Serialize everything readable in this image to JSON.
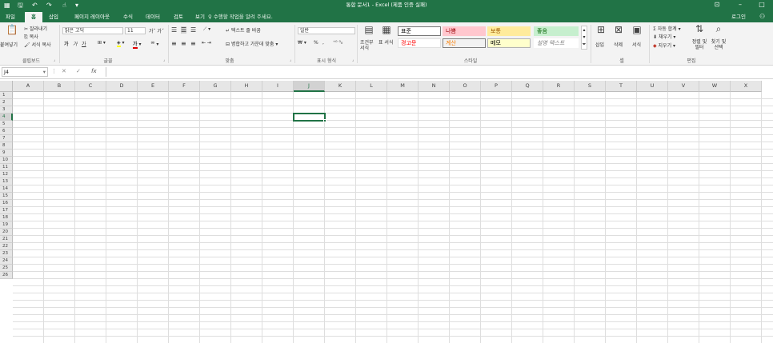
{
  "window": {
    "title": "통합 문서1 - Excel (제품 인증 실패)",
    "qa_icons": [
      "excel-icon",
      "save-icon",
      "undo-icon",
      "redo-icon",
      "touch-mode-icon",
      "customize-icon"
    ],
    "controls": [
      "ribbon-display-icon",
      "minimize-icon",
      "maximize-icon"
    ]
  },
  "tabs": [
    "파일",
    "홈",
    "삽입",
    "페이지 레이아웃",
    "수식",
    "데이터",
    "검토",
    "보기"
  ],
  "active_tab": "홈",
  "tellme": "수행할 작업을 알려 주세요.",
  "signin": "로그인",
  "ribbon": {
    "clipboard": {
      "paste": "붙여넣기",
      "cut": "잘라내기",
      "copy": "복사",
      "format_painter": "서식 복사",
      "label": "클립보드"
    },
    "font": {
      "name": "맑은 고딕",
      "size": "11",
      "bold": "가",
      "italic": "가",
      "underline": "가",
      "label": "글꼴"
    },
    "alignment": {
      "wrap": "텍스트 줄 바꿈",
      "merge": "병합하고 가운데 맞춤",
      "label": "맞춤"
    },
    "number": {
      "format": "일반",
      "percent": "%",
      "comma": ",",
      "label": "표시 형식"
    },
    "styles": {
      "conditional": "조건부 서식",
      "table": "표 서식",
      "items": [
        {
          "label": "표준",
          "bg": "#ffffff",
          "fg": "#000000",
          "border": "#767676"
        },
        {
          "label": "나쁨",
          "bg": "#ffc7ce",
          "fg": "#9c0006",
          "border": "#ffc7ce"
        },
        {
          "label": "보통",
          "bg": "#ffeb9c",
          "fg": "#9c5700",
          "border": "#ffeb9c"
        },
        {
          "label": "좋음",
          "bg": "#c6efce",
          "fg": "#006100",
          "border": "#c6efce"
        },
        {
          "label": "경고문",
          "bg": "#ffffff",
          "fg": "#ff0000",
          "border": "#e0e0e0"
        },
        {
          "label": "계산",
          "bg": "#f2f2f2",
          "fg": "#fa7d00",
          "border": "#7f7f7f"
        },
        {
          "label": "메모",
          "bg": "#ffffcc",
          "fg": "#000000",
          "border": "#b2b2b2"
        },
        {
          "label": "설명 텍스트",
          "bg": "#ffffff",
          "fg": "#7f7f7f",
          "border": "#ffffff"
        }
      ],
      "label": "스타일"
    },
    "cells": {
      "insert": "삽입",
      "delete": "삭제",
      "format": "서식",
      "label": "셀"
    },
    "editing": {
      "autosum": "자동 합계",
      "fill": "채우기",
      "clear": "지우기",
      "sort": "정렬 및 필터",
      "find": "찾기 및 선택",
      "label": "편집"
    }
  },
  "formula_bar": {
    "name_box": "J4",
    "content": ""
  },
  "grid": {
    "columns": [
      "A",
      "B",
      "C",
      "D",
      "E",
      "F",
      "G",
      "H",
      "I",
      "J",
      "K",
      "L",
      "M",
      "N",
      "O",
      "P",
      "Q",
      "R",
      "S",
      "T",
      "U",
      "V",
      "W",
      "X"
    ],
    "rows": [
      "1",
      "2",
      "3",
      "4",
      "5",
      "6",
      "7",
      "8",
      "9",
      "10",
      "11",
      "12",
      "13",
      "14",
      "15",
      "16",
      "17",
      "18",
      "19",
      "20",
      "21",
      "22",
      "23",
      "24",
      "25",
      "26"
    ],
    "active_col": "J",
    "active_row": "4"
  },
  "colors": {
    "accent": "#217346"
  }
}
